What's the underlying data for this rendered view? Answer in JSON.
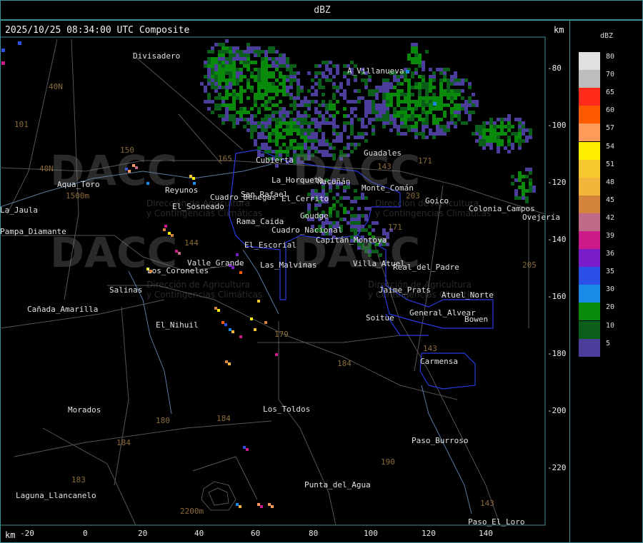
{
  "header": {
    "title": "dBZ"
  },
  "map": {
    "timestamp": "2025/10/25 08:34:00 UTC Composite",
    "unit_top": "km",
    "unit_bottom": "km",
    "y_ticks": [
      "-80",
      "-100",
      "-120",
      "-140",
      "-160",
      "-180",
      "-200",
      "-220"
    ],
    "x_ticks": [
      "-20",
      "0",
      "20",
      "40",
      "60",
      "80",
      "100",
      "120",
      "140"
    ],
    "places": [
      "Divisadero",
      "A_Villanueva",
      "Guadales",
      "Aqua_Toro",
      "Reyunos",
      "La_Jaula",
      "Pampa_Diamante",
      "El_Sosneado",
      "Rama_Caida",
      "Las_Malvinas",
      "Goudge",
      "Cuadro_Benegas",
      "San_Rafael",
      "El_Cerrito",
      "Ñacuñán",
      "Monte_Comán",
      "Salinas",
      "El_Nihuil",
      "Real_del_Padre",
      "Cañada_Amarilla",
      "La_Horqueta",
      "Villa_Atuel",
      "El_Escorial",
      "Jaime_Prats",
      "Soitue",
      "Bowen",
      "Carmensa",
      "General_Alvear",
      "Paso_Burroso",
      "Los_Toldos",
      "Punta_del_Agua",
      "Morados",
      "Laguna_Llancanelo",
      "Paso_El_Loro",
      "Cuadro_Nacional",
      "Valle_Grande",
      "Capitán_Montoya",
      "Los_Coroneles",
      "Goico",
      "Colonia_Campos",
      "Ovejería",
      "Atuel_Norte",
      "Cubierta"
    ],
    "routes": [
      "101",
      "40N",
      "40N",
      "150",
      "144",
      "165",
      "143",
      "171",
      "203",
      "171",
      "205",
      "179",
      "184",
      "180",
      "184",
      "190",
      "184",
      "183",
      "143",
      "143"
    ],
    "watermark_brand": "DACC",
    "watermark_sub1": "Dirección de Agricultura",
    "watermark_sub2": "y Contingencias Climáticas",
    "altitude_labels": [
      "1500m",
      "2200m"
    ]
  },
  "legend": {
    "title": "dBZ",
    "levels": [
      {
        "label": "80",
        "color": "#e0e0e0"
      },
      {
        "label": "70",
        "color": "#bdbdbd"
      },
      {
        "label": "65",
        "color": "#ff2a1a"
      },
      {
        "label": "60",
        "color": "#ff5a00"
      },
      {
        "label": "57",
        "color": "#ff9a5a"
      },
      {
        "label": "54",
        "color": "#ffee00"
      },
      {
        "label": "51",
        "color": "#f6c72e"
      },
      {
        "label": "48",
        "color": "#f4b63a"
      },
      {
        "label": "45",
        "color": "#d4843a"
      },
      {
        "label": "42",
        "color": "#c06a8a"
      },
      {
        "label": "39",
        "color": "#cc1a8a"
      },
      {
        "label": "36",
        "color": "#7a1ecc"
      },
      {
        "label": "35",
        "color": "#2a50e8"
      },
      {
        "label": "30",
        "color": "#1a8ae8"
      },
      {
        "label": "20",
        "color": "#0a8a0a"
      },
      {
        "label": "10",
        "color": "#0a5e1a"
      },
      {
        "label": "5",
        "color": "#4a3e9a"
      }
    ]
  }
}
